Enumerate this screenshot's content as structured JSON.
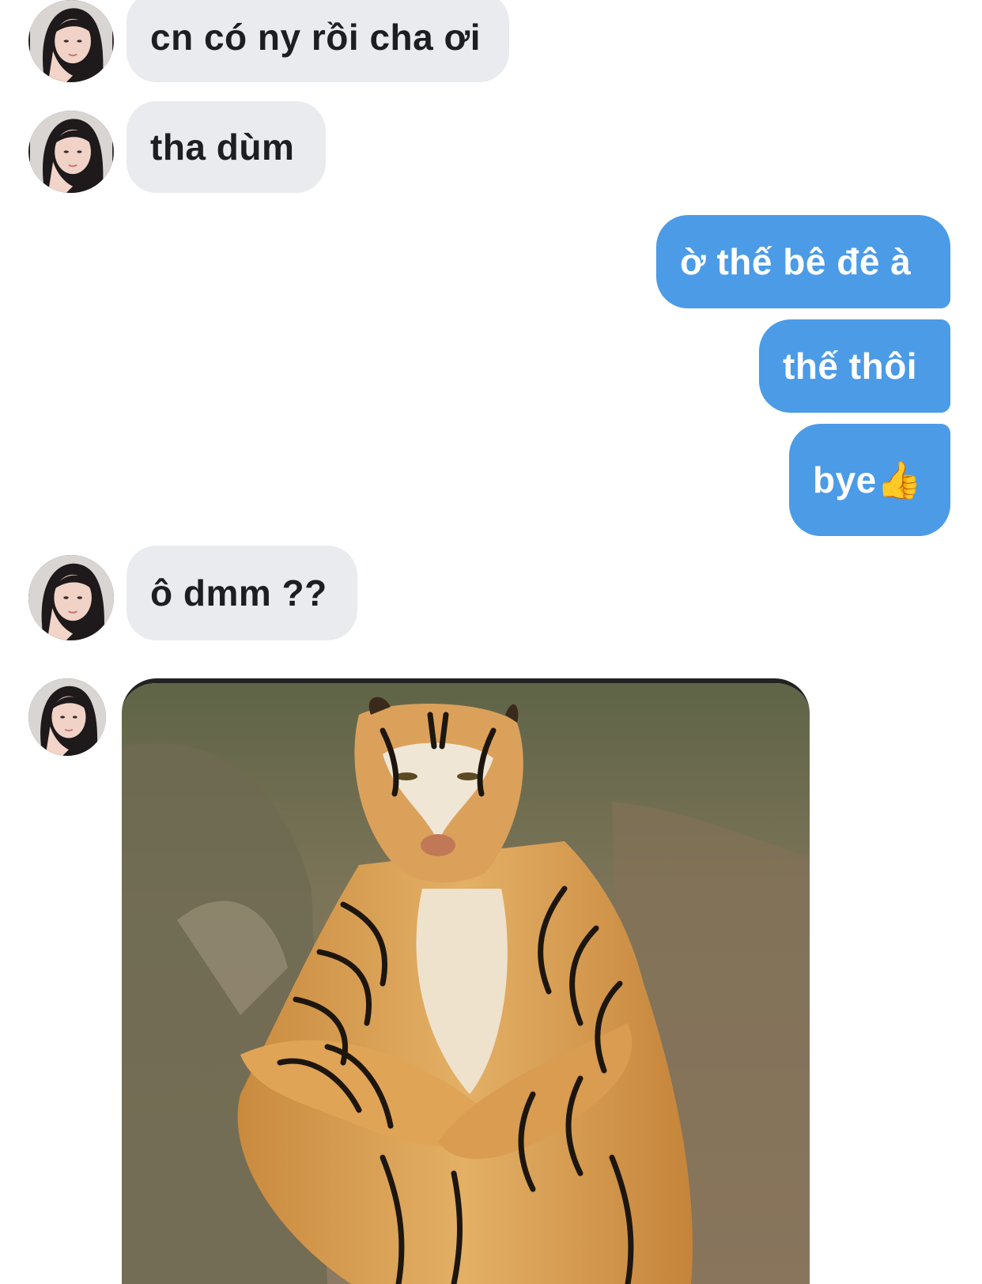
{
  "messages": [
    {
      "sender": "contact",
      "text": "cn có ny rồi cha ơi"
    },
    {
      "sender": "contact",
      "text": "tha dùm"
    },
    {
      "sender": "me",
      "text": "ờ thế bê đê à"
    },
    {
      "sender": "me",
      "text": "thế thôi"
    },
    {
      "sender": "me",
      "text": "bye👍"
    },
    {
      "sender": "contact",
      "text": "ô dmm ??"
    },
    {
      "sender": "contact",
      "type": "image",
      "image": "tiger-sitting-photo"
    }
  ],
  "colors": {
    "incoming_bubble": "#e9ebee",
    "outgoing_bubble": "#4b9be7",
    "incoming_text": "#1c1e21",
    "outgoing_text": "#ffffff"
  },
  "icons": {
    "contact_avatar": "avatar-woman-icon"
  }
}
